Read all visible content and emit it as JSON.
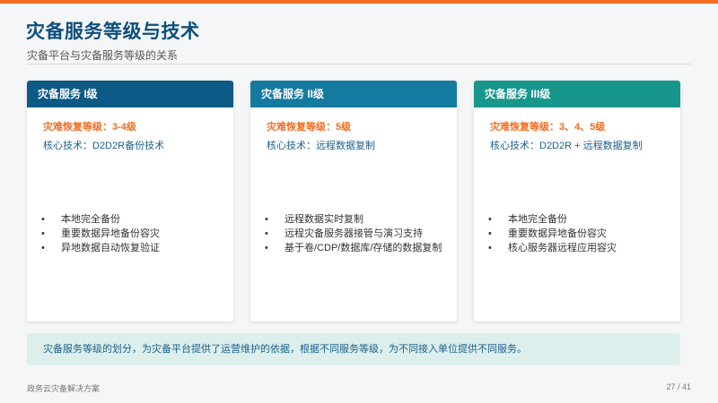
{
  "header": {
    "title": "灾备服务等级与技术",
    "subtitle": "灾备平台与灾备服务等级的关系"
  },
  "cards": [
    {
      "header_color": "#0d5a86",
      "title": "灾备服务 I级",
      "level": "灾难恢复等级：3-4级",
      "tech": "核心技术：D2D2R备份技术",
      "features": [
        "本地完全备份",
        "重要数据异地备份容灾",
        "异地数据自动恢复验证"
      ]
    },
    {
      "header_color": "#147aa0",
      "title": "灾备服务 II级",
      "level": "灾难恢复等级：5级",
      "tech": "核心技术：远程数据复制",
      "features": [
        "远程数据实时复制",
        "远程灾备服务器接管与演习支持",
        "基于卷/CDP/数据库/存储的数据复制"
      ]
    },
    {
      "header_color": "#17968c",
      "title": "灾备服务 III级",
      "level": "灾难恢复等级：3、4、5级",
      "tech": "核心技术：D2D2R + 远程数据复制",
      "features": [
        "本地完全备份",
        "重要数据异地备份容灾",
        "核心服务器远程应用容灾"
      ]
    }
  ],
  "bullet_char": "•",
  "note": "灾备服务等级的划分，为灾备平台提供了运营维护的依据，根据不同服务等级，为不同接入单位提供不同服务。",
  "footer": {
    "left": "政务云灾备解决方案",
    "page": "27 / 41"
  },
  "colors": {
    "accent_orange": "#f26d21",
    "title_blue": "#0b4f7d",
    "note_bg": "#dcefec"
  }
}
